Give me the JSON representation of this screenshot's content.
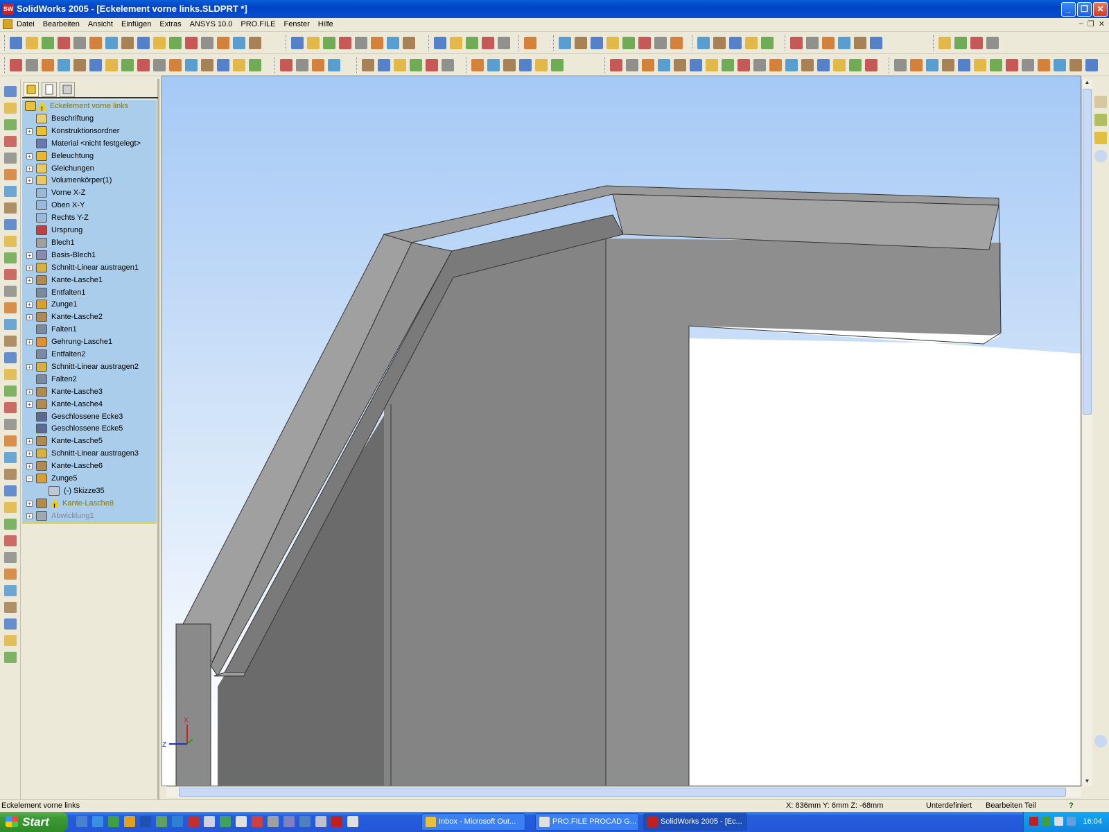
{
  "window": {
    "title": "SolidWorks 2005 - [Eckelement vorne links.SLDPRT *]",
    "controls": {
      "minimize": "_",
      "maximize": "❐",
      "close": "✕"
    }
  },
  "menu": {
    "items": [
      "Datei",
      "Bearbeiten",
      "Ansicht",
      "Einfügen",
      "Extras",
      "ANSYS 10.0",
      "PRO.FILE",
      "Fenster",
      "Hilfe"
    ],
    "doc_controls": [
      "–",
      "❐",
      "✕"
    ]
  },
  "tree": {
    "root": "Eckelement vorne links",
    "items": [
      {
        "label": "Beschriftung",
        "expander": "",
        "icon": "annotation-icon",
        "color": "#e8d070"
      },
      {
        "label": "Konstruktionsordner",
        "expander": "+",
        "icon": "design-binder-icon",
        "color": "#e8c030"
      },
      {
        "label": "Material <nicht festgelegt>",
        "expander": "",
        "icon": "material-icon",
        "color": "#6a7ab0"
      },
      {
        "label": "Beleuchtung",
        "expander": "+",
        "icon": "lighting-icon",
        "color": "#e8b830"
      },
      {
        "label": "Gleichungen",
        "expander": "+",
        "icon": "equations-icon",
        "color": "#e8c860"
      },
      {
        "label": "Volumenkörper(1)",
        "expander": "+",
        "icon": "solid-bodies-icon",
        "color": "#e8c860"
      },
      {
        "label": "Vorne X-Z",
        "expander": "",
        "icon": "plane-icon",
        "color": "#9ab8d8"
      },
      {
        "label": "Oben X-Y",
        "expander": "",
        "icon": "plane-icon",
        "color": "#9ab8d8"
      },
      {
        "label": "Rechts Y-Z",
        "expander": "",
        "icon": "plane-icon",
        "color": "#9ab8d8"
      },
      {
        "label": "Ursprung",
        "expander": "",
        "icon": "origin-icon",
        "color": "#c04040"
      },
      {
        "label": "Blech1",
        "expander": "",
        "icon": "sheet-metal-icon",
        "color": "#a0a0a0"
      },
      {
        "label": "Basis-Blech1",
        "expander": "+",
        "icon": "base-flange-icon",
        "color": "#8a8ab0"
      },
      {
        "label": "Schnitt-Linear austragen1",
        "expander": "+",
        "icon": "cut-extrude-icon",
        "color": "#d8b040"
      },
      {
        "label": "Kante-Lasche1",
        "expander": "+",
        "icon": "edge-flange-icon",
        "color": "#b08a50"
      },
      {
        "label": "Entfalten1",
        "expander": "",
        "icon": "unfold-icon",
        "color": "#7a8aa0"
      },
      {
        "label": "Zunge1",
        "expander": "+",
        "icon": "tab-icon",
        "color": "#d8a030"
      },
      {
        "label": "Kante-Lasche2",
        "expander": "+",
        "icon": "edge-flange-icon",
        "color": "#b08a50"
      },
      {
        "label": "Falten1",
        "expander": "",
        "icon": "fold-icon",
        "color": "#7a8aa0"
      },
      {
        "label": "Gehrung-Lasche1",
        "expander": "+",
        "icon": "miter-flange-icon",
        "color": "#e09030"
      },
      {
        "label": "Entfalten2",
        "expander": "",
        "icon": "unfold-icon",
        "color": "#7a8aa0"
      },
      {
        "label": "Schnitt-Linear austragen2",
        "expander": "+",
        "icon": "cut-extrude-icon",
        "color": "#d8b040"
      },
      {
        "label": "Falten2",
        "expander": "",
        "icon": "fold-icon",
        "color": "#7a8aa0"
      },
      {
        "label": "Kante-Lasche3",
        "expander": "+",
        "icon": "edge-flange-icon",
        "color": "#b08a50"
      },
      {
        "label": "Kante-Lasche4",
        "expander": "+",
        "icon": "edge-flange-icon",
        "color": "#b08a50"
      },
      {
        "label": "Geschlossene Ecke3",
        "expander": "",
        "icon": "closed-corner-icon",
        "color": "#5a6a90"
      },
      {
        "label": "Geschlossene Ecke5",
        "expander": "",
        "icon": "closed-corner-icon",
        "color": "#5a6a90"
      },
      {
        "label": "Kante-Lasche5",
        "expander": "+",
        "icon": "edge-flange-icon",
        "color": "#b08a50"
      },
      {
        "label": "Schnitt-Linear austragen3",
        "expander": "+",
        "icon": "cut-extrude-icon",
        "color": "#d8b040"
      },
      {
        "label": "Kante-Lasche6",
        "expander": "+",
        "icon": "edge-flange-icon",
        "color": "#b08a50"
      },
      {
        "label": "Zunge5",
        "expander": "–",
        "icon": "tab-icon",
        "color": "#d8a030"
      },
      {
        "label": "(-) Skizze35",
        "expander": "",
        "icon": "sketch-icon",
        "color": "#c0c8d8",
        "indent": true
      },
      {
        "label": "Kante-Lasche8",
        "expander": "+",
        "icon": "edge-flange-icon",
        "color": "#b08a50",
        "warning": true,
        "state": "warning"
      },
      {
        "label": "Abwicklung1",
        "expander": "+",
        "icon": "flat-pattern-icon",
        "color": "#a0a8b0",
        "state": "suppressed"
      }
    ]
  },
  "triad": {
    "x_label": "X",
    "z_label": "Z"
  },
  "status": {
    "part_name": "Eckelement vorne links",
    "coordinates": "X: 836mm  Y: 6mm  Z: -68mm",
    "definition_state": "Unterdefiniert",
    "mode": "Bearbeiten Teil",
    "help": "?"
  },
  "taskbar": {
    "start_label": "Start",
    "tasks": [
      {
        "label": "Inbox - Microsoft Out...",
        "icon": "outlook-icon",
        "color": "#e8c040"
      },
      {
        "label": "PRO.FILE PROCAD G...",
        "icon": "profile-app-icon",
        "color": "#e0e0e0"
      },
      {
        "label": "SolidWorks 2005 - [Ec...",
        "icon": "solidworks-icon",
        "color": "#c02020"
      }
    ],
    "clock": "16:04"
  },
  "colors": {
    "tree_background": "#a9cdea",
    "viewport_top": "#a5c9f6",
    "model_gray": "#8c8c8c",
    "warning_text": "#8a7a00"
  }
}
